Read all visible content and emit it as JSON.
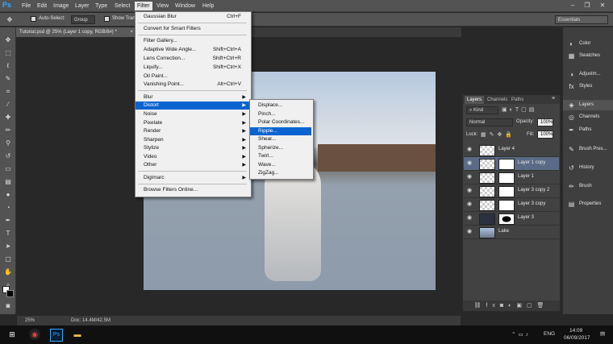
{
  "app": {
    "logo": "Ps"
  },
  "menubar": {
    "items": [
      "File",
      "Edit",
      "Image",
      "Layer",
      "Type",
      "Select",
      "Filter",
      "View",
      "Window",
      "Help"
    ],
    "active": "Filter"
  },
  "options_bar": {
    "auto_select_label": "Auto-Select:",
    "auto_select_value": "Group",
    "show_transform_label": "Show Trans",
    "workspace": "Essentials"
  },
  "document_tab": {
    "title": "Tutorial.psd @ 25% (Layer 1 copy, RGB/8#) *",
    "close": "×"
  },
  "status_bar": {
    "zoom": "25%",
    "doc": "Doc: 14.4M/42.5M"
  },
  "filter_menu": {
    "items": [
      {
        "label": "Gaussian Blur",
        "shortcut": "Ctrl+F"
      },
      {
        "label": "Convert for Smart Filters",
        "shortcut": ""
      },
      {
        "label": "Filter Gallery...",
        "shortcut": ""
      },
      {
        "label": "Adaptive Wide Angle...",
        "shortcut": "Shift+Ctrl+A"
      },
      {
        "label": "Lens Correction...",
        "shortcut": "Shift+Ctrl+R"
      },
      {
        "label": "Liquify...",
        "shortcut": "Shift+Ctrl+X"
      },
      {
        "label": "Oil Paint...",
        "shortcut": ""
      },
      {
        "label": "Vanishing Point...",
        "shortcut": "Alt+Ctrl+V"
      },
      {
        "label": "Blur",
        "shortcut": ""
      },
      {
        "label": "Distort",
        "shortcut": ""
      },
      {
        "label": "Noise",
        "shortcut": ""
      },
      {
        "label": "Pixelate",
        "shortcut": ""
      },
      {
        "label": "Render",
        "shortcut": ""
      },
      {
        "label": "Sharpen",
        "shortcut": ""
      },
      {
        "label": "Stylize",
        "shortcut": ""
      },
      {
        "label": "Video",
        "shortcut": ""
      },
      {
        "label": "Other",
        "shortcut": ""
      },
      {
        "label": "Digimarc",
        "shortcut": ""
      },
      {
        "label": "Browse Filters Online...",
        "shortcut": ""
      }
    ],
    "highlighted": "Distort"
  },
  "distort_submenu": {
    "items": [
      "Displace...",
      "Pinch...",
      "Polar Coordinates...",
      "Ripple...",
      "Shear...",
      "Spherize...",
      "Twirl...",
      "Wave...",
      "ZigZag..."
    ],
    "highlighted": "Ripple..."
  },
  "layers_panel": {
    "tabs": [
      "Layers",
      "Channels",
      "Paths"
    ],
    "kind_label": "Kind",
    "blend_mode": "Normal",
    "opacity_label": "Opacity:",
    "opacity_value": "100%",
    "lock_label": "Lock:",
    "fill_label": "Fill:",
    "fill_value": "100%",
    "layers": [
      {
        "name": "Layer 4",
        "selected": false
      },
      {
        "name": "Layer 1 copy",
        "selected": true
      },
      {
        "name": "Layer 1",
        "selected": false
      },
      {
        "name": "Layer 3 copy 2",
        "selected": false
      },
      {
        "name": "Layer 3 copy",
        "selected": false
      },
      {
        "name": "Layer 3",
        "selected": false
      },
      {
        "name": "Lake",
        "selected": false
      }
    ]
  },
  "dock_panels": [
    "Color",
    "Swatches",
    "Adjustm...",
    "Styles",
    "Layers",
    "Channels",
    "Paths",
    "Brush Pres...",
    "History",
    "Brush",
    "Properties"
  ],
  "taskbar": {
    "lang": "ENG",
    "time": "14:09",
    "date": "06/09/2017"
  },
  "colors": {
    "accent": "#0a64d0",
    "selected_layer": "#5b6a86",
    "ps_blue": "#35a7ff"
  }
}
